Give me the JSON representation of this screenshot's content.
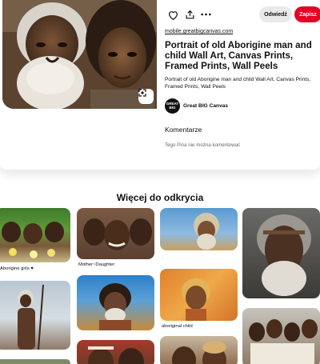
{
  "pin": {
    "actions": {
      "like_icon": "heart-icon",
      "share_icon": "share-icon",
      "more_icon": "ellipsis-icon"
    },
    "visit_label": "Odwiedź",
    "save_label": "Zapisz",
    "source_link": "mobile.greatbigcanvas.com",
    "title": "Portrait of old Aborigine man and child Wall Art, Canvas Prints, Framed Prints, Wall Peels",
    "description": "Portrait of old Aborigine man and child Wall Art, Canvas Prints, Framed Prints, Wall Peels",
    "creator": {
      "name": "Great BIG Canvas",
      "avatar_text": "GREAT BIG"
    },
    "lens_icon": "visual-search-icon"
  },
  "comments": {
    "heading": "Komentarze",
    "disabled_note": "Tego Pina nie można komentować"
  },
  "explore": {
    "heading": "Więcej do odkrycia",
    "captions": {
      "col1_first": "Aborigine girls ♥",
      "col2_first": "Mother~Daughter",
      "col3_first": ".",
      "col3_second": "aboriginal child"
    }
  },
  "colors": {
    "accent": "#e60023",
    "visit_bg": "#e9e9e9"
  }
}
